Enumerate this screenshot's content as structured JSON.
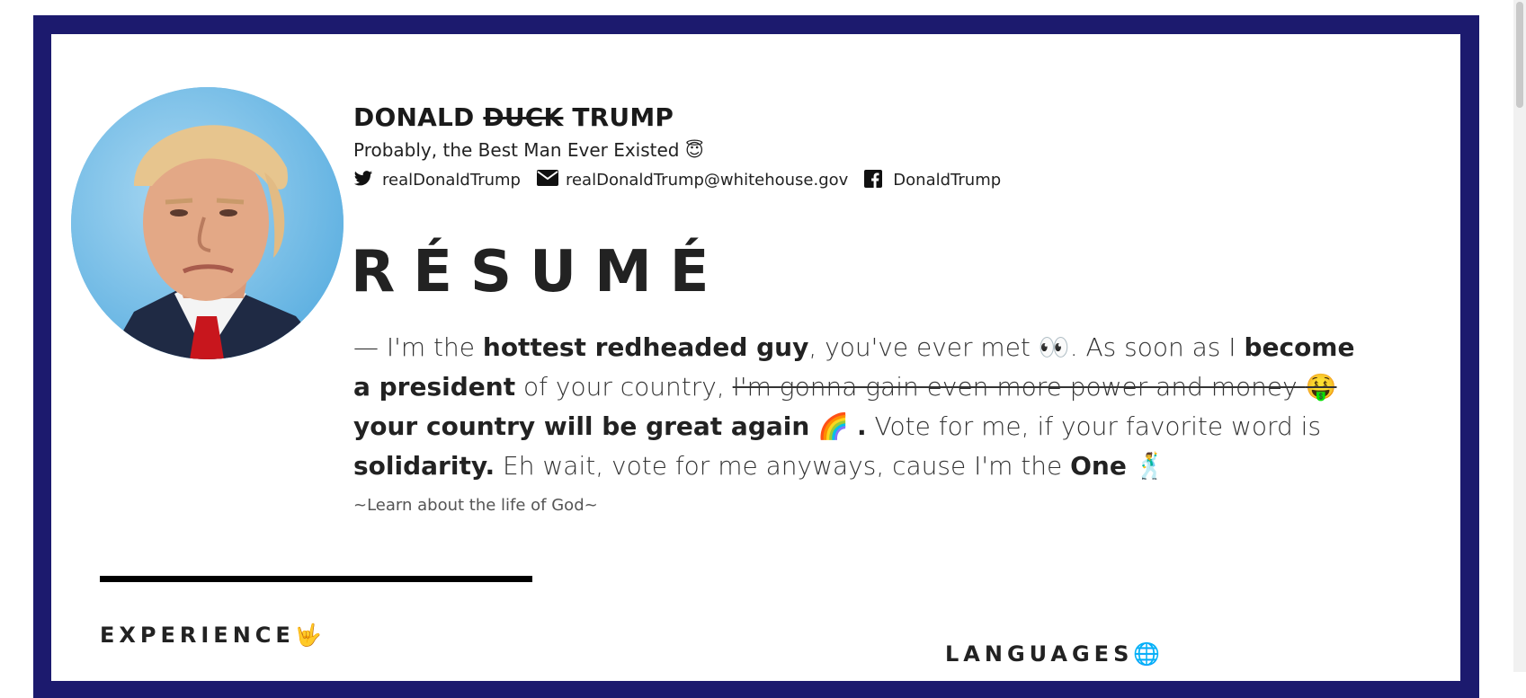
{
  "header": {
    "name_first": "DONALD",
    "name_struck": "DUCK",
    "name_last": "TRUMP",
    "tagline": "Probably, the Best Man Ever Existed",
    "tagline_emoji": "😇",
    "contacts": [
      {
        "icon": "twitter-icon",
        "label": "realDonaldTrump"
      },
      {
        "icon": "envelope-icon",
        "label": "realDonaldTrump@whitehouse.gov"
      },
      {
        "icon": "facebook-icon",
        "label": "DonaldTrump"
      }
    ]
  },
  "resume": {
    "title": "RÉSUMÉ",
    "bio": {
      "p1": "— I'm the ",
      "b1": "hottest redheaded guy",
      "p2": ", you've ever met ",
      "e1": "👀",
      "p3": ". As soon as I ",
      "b2": "become a president",
      "p4": " of your country, ",
      "struck": "I'm gonna gain even more power and money ",
      "e2": "🤑",
      "p5": " ",
      "b3": "your country will be great again",
      "e3": "🌈",
      "p6": " ",
      "b4": ".",
      "p7": " Vote for me, if your favorite word is ",
      "b5": "solidarity.",
      "p8": " Eh wait, vote for me anyways, cause I'm the ",
      "b6": "One",
      "e4": "🕺"
    },
    "learn_more": "~Learn about the life of God~"
  },
  "sections": {
    "experience": "EXPERIENCE",
    "experience_emoji": "🤟",
    "languages": "LANGUAGES",
    "languages_emoji": "🌐"
  },
  "colors": {
    "frame": "#1c1a6e",
    "text": "#222222"
  }
}
